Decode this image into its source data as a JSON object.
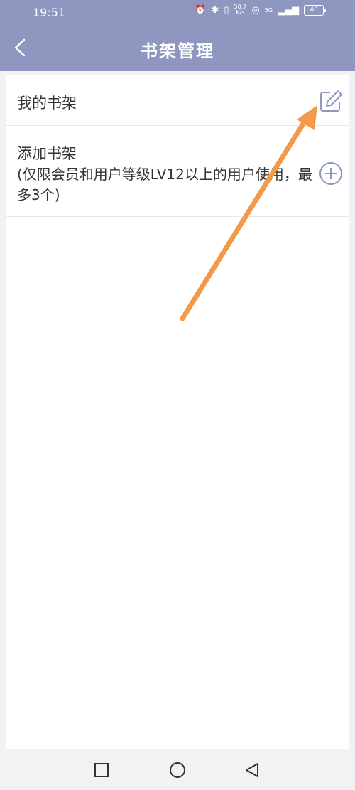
{
  "status_bar": {
    "time": "19:51",
    "network_speed": "50.7\nK/s",
    "signal_label": "5G",
    "battery": "40"
  },
  "header": {
    "title": "书架管理",
    "back_icon": "chevron-left-icon"
  },
  "bookshelf": {
    "my_shelf_label": "我的书架",
    "edit_icon": "edit-icon",
    "add_shelf_label": "添加书架",
    "add_shelf_note": "(仅限会员和用户等级LV12以上的用户使用，最多3个)",
    "add_icon": "plus-circle-icon"
  },
  "nav_bar": {
    "buttons": [
      "square-icon",
      "circle-icon",
      "triangle-back-icon"
    ]
  },
  "colors": {
    "header_bg": "#8f96c0",
    "accent": "#8f96c0",
    "arrow": "#f29a4a"
  }
}
